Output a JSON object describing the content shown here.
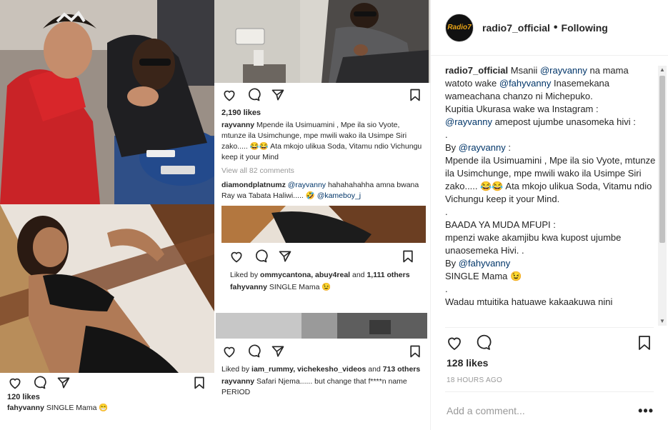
{
  "left_post": {
    "likes": "120 likes",
    "caption_user": "fahyvanny",
    "caption_text": " SINGLE Mama 😁"
  },
  "right_post_1": {
    "likes": "2,190 likes",
    "caption_user": "rayvanny",
    "caption_text": " Mpende ila Usimuamini , Mpe ila sio Vyote, mtunze ila Usimchunge, mpe mwili wako ila Usimpe Siri zako..... 😂😂 Ata mkojo ulikua Soda, Vitamu ndio Vichungu keep it your Mind",
    "view_all": "View all 82 comments",
    "comment_user": "diamondplatnumz",
    "comment_mention": "@rayvanny",
    "comment_text": " hahahahahha amna bwana Ray wa Tabata Haliwi..... 🤣 ",
    "comment_mention2": "@kameboy_j"
  },
  "right_post_2": {
    "liked_by_prefix": "Liked by ",
    "liked_by_users": "ommycantona, abuy4real",
    "liked_by_and": " and ",
    "liked_by_count": "1,111 others",
    "caption_user": "fahyvanny",
    "caption_text": " SINGLE Mama 😉"
  },
  "right_post_3": {
    "liked_by_prefix": "Liked by ",
    "liked_by_users": "iam_rummy, vichekesho_videos",
    "liked_by_and": " and ",
    "liked_by_count": "713 others",
    "caption_user": "rayvanny",
    "caption_text": " Safari Njema...... but change that f****n name PERIOD"
  },
  "header": {
    "avatar_text": "Radio7",
    "username": "radio7_official",
    "dot": "•",
    "follow": "Following"
  },
  "caption": {
    "username": "radio7_official",
    "l1": " Msanii ",
    "m1": "@rayvanny",
    "l2": " na mama watoto wake ",
    "m2": "@fahyvanny",
    "l3": " Inasemekana wameachana chanzo ni Michepuko.",
    "l4": "Kupitia Ukurasa wake wa Instagram :",
    "m3": "@rayvanny",
    "l5": " amepost ujumbe unasomeka hivi :",
    "dot1": ".",
    "by1": "By ",
    "m4": "@rayvanny",
    "by1b": " :",
    "l6": "Mpende ila Usimuamini , Mpe ila sio Vyote, mtunze ila Usimchunge, mpe mwili wako ila Usimpe Siri zako..... 😂😂 Ata mkojo ulikua Soda, Vitamu ndio Vichungu keep it your Mind.",
    "dot2": ".",
    "l7": "BAADA YA MUDA MFUPI :",
    "l8": "mpenzi wake akamjibu kwa kupost ujumbe unaosemeka Hivi. .",
    "by2": "By ",
    "m5": "@fahyvanny",
    "l9": "SINGLE Mama 😉",
    "dot3": ".",
    "l10": "Wadau mtuitika hatuawe kakaakuwa nini"
  },
  "panel": {
    "likes": "128 likes",
    "time": "18 HOURS AGO",
    "add_comment_placeholder": "Add a comment...",
    "more": "•••"
  },
  "colors": {
    "mention": "#003569",
    "text": "#262626",
    "muted": "#999999",
    "dress_red": "#d8262a"
  },
  "icons": [
    "heart-icon",
    "comment-icon",
    "share-icon",
    "bookmark-icon",
    "more-icon"
  ]
}
